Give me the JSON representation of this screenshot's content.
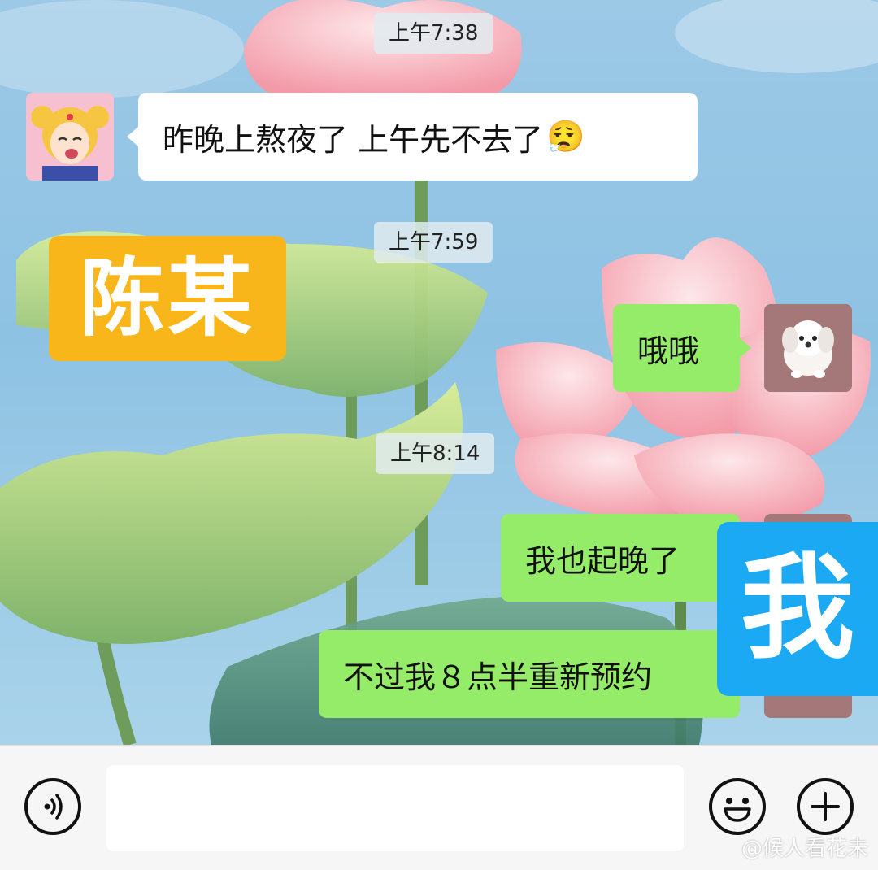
{
  "messages": {
    "time1": "上午7:38",
    "msg1": "昨晚上熬夜了 上午先不去了",
    "msg1_emoji": "😮‍💨",
    "time2": "上午7:59",
    "msg2": "哦哦",
    "time3": "上午8:14",
    "msg3": "我也起晚了",
    "msg4": "不过我８点半重新预约"
  },
  "labels": {
    "contact": "陈某",
    "me": "我"
  },
  "watermark": "@候人看花未",
  "icons": {
    "voice": "voice-icon",
    "emoji": "emoji-icon",
    "add": "plus-icon"
  },
  "colors": {
    "sent_bubble": "#95ec69",
    "received_bubble": "#ffffff",
    "contact_label": "#f8b61a",
    "me_label": "#1ba9f3"
  }
}
